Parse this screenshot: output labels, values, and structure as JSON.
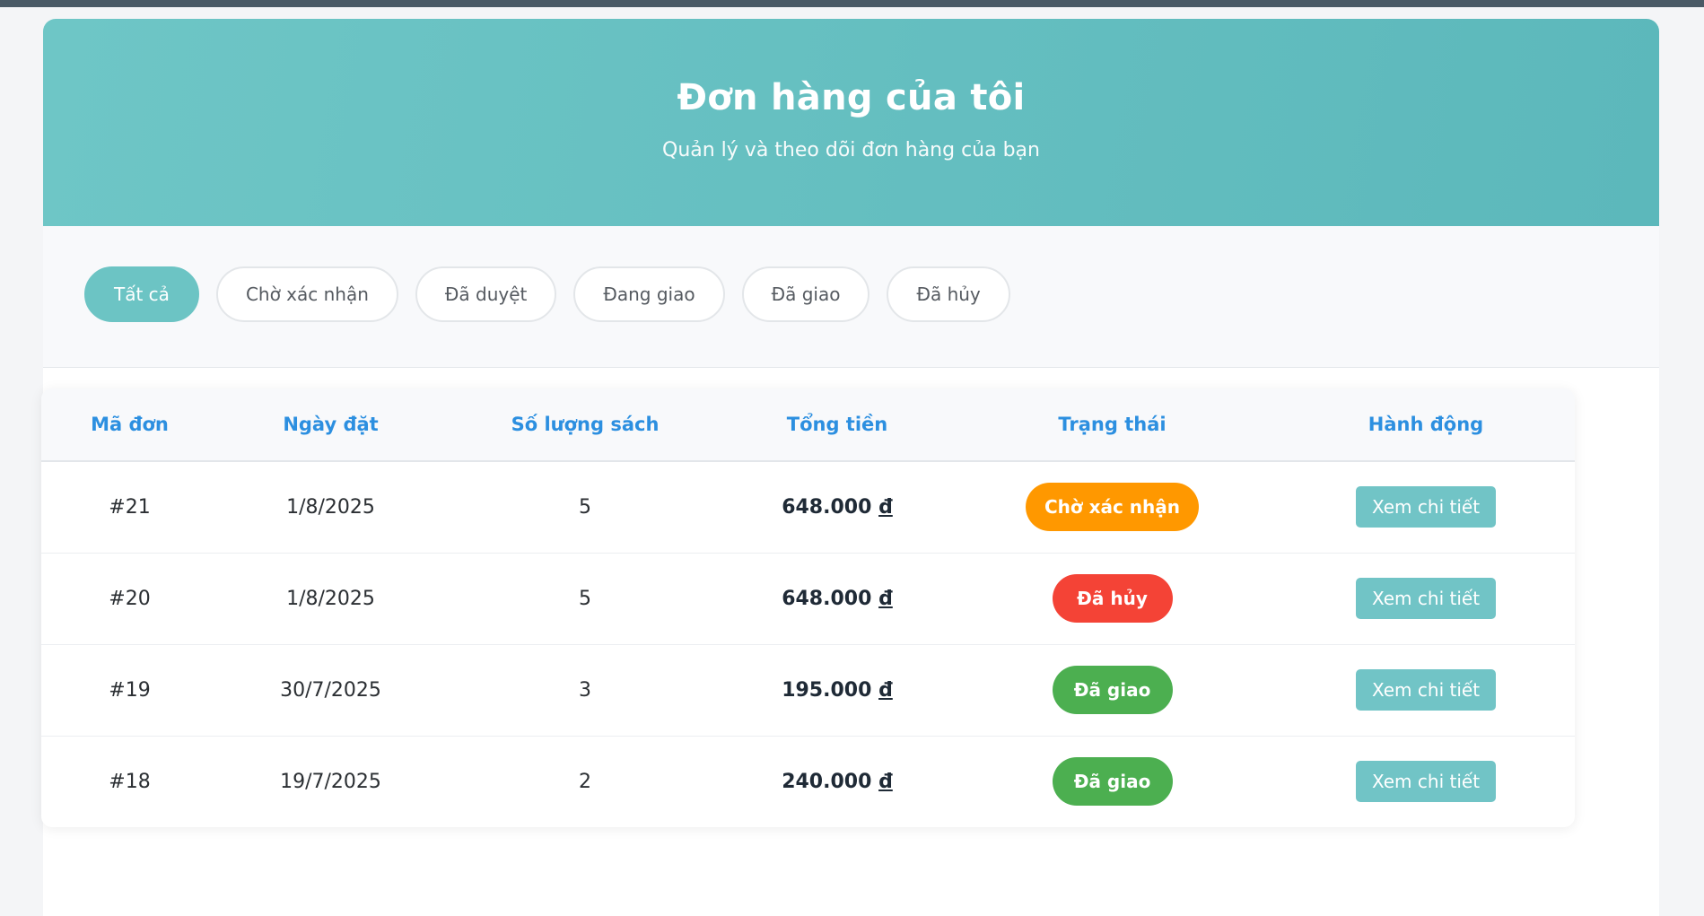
{
  "header": {
    "title": "Đơn hàng của tôi",
    "subtitle": "Quản lý và theo dõi đơn hàng của bạn"
  },
  "filters": [
    {
      "label": "Tất cả",
      "active": true
    },
    {
      "label": "Chờ xác nhận",
      "active": false
    },
    {
      "label": "Đã duyệt",
      "active": false
    },
    {
      "label": "Đang giao",
      "active": false
    },
    {
      "label": "Đã giao",
      "active": false
    },
    {
      "label": "Đã hủy",
      "active": false
    }
  ],
  "table": {
    "columns": [
      "Mã đơn",
      "Ngày đặt",
      "Số lượng sách",
      "Tổng tiền",
      "Trạng thái",
      "Hành động"
    ],
    "rows": [
      {
        "id": "#21",
        "date": "1/8/2025",
        "qty": "5",
        "total": "648.000",
        "currency": "đ",
        "status": "Chờ xác nhận",
        "status_color": "#ff9800",
        "action": "Xem chi tiết"
      },
      {
        "id": "#20",
        "date": "1/8/2025",
        "qty": "5",
        "total": "648.000",
        "currency": "đ",
        "status": "Đã hủy",
        "status_color": "#f44336",
        "action": "Xem chi tiết"
      },
      {
        "id": "#19",
        "date": "30/7/2025",
        "qty": "3",
        "total": "195.000",
        "currency": "đ",
        "status": "Đã giao",
        "status_color": "#4caf50",
        "action": "Xem chi tiết"
      },
      {
        "id": "#18",
        "date": "19/7/2025",
        "qty": "2",
        "total": "240.000",
        "currency": "đ",
        "status": "Đã giao",
        "status_color": "#4caf50",
        "action": "Xem chi tiết"
      }
    ]
  },
  "colors": {
    "accent": "#6cc4c4",
    "header_text": "#2c8fe0"
  }
}
